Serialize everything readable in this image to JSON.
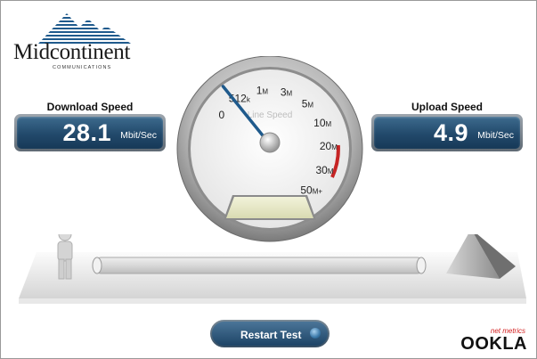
{
  "brand": {
    "name": "Midcontinent",
    "subtitle": "COMMUNICATIONS"
  },
  "download": {
    "label": "Download Speed",
    "value": "28.1",
    "unit": "Mbit/Sec"
  },
  "upload": {
    "label": "Upload Speed",
    "value": "4.9",
    "unit": "Mbit/Sec"
  },
  "gauge": {
    "title": "Line Speed",
    "scale": [
      {
        "text": "0",
        "sub": ""
      },
      {
        "text": "512",
        "sub": "k"
      },
      {
        "text": "1",
        "sub": "M"
      },
      {
        "text": "3",
        "sub": "M"
      },
      {
        "text": "5",
        "sub": "M"
      },
      {
        "text": "10",
        "sub": "M"
      },
      {
        "text": "20",
        "sub": "M"
      },
      {
        "text": "30",
        "sub": "M"
      },
      {
        "text": "50",
        "sub": "M+"
      }
    ],
    "needle_level": 0.08
  },
  "actions": {
    "restart_label": "Restart Test"
  },
  "footer": {
    "provider_small": "net metrics",
    "provider_name": "OOKLA"
  },
  "colors": {
    "panel": "#22496b",
    "accent_red": "#d32020"
  }
}
